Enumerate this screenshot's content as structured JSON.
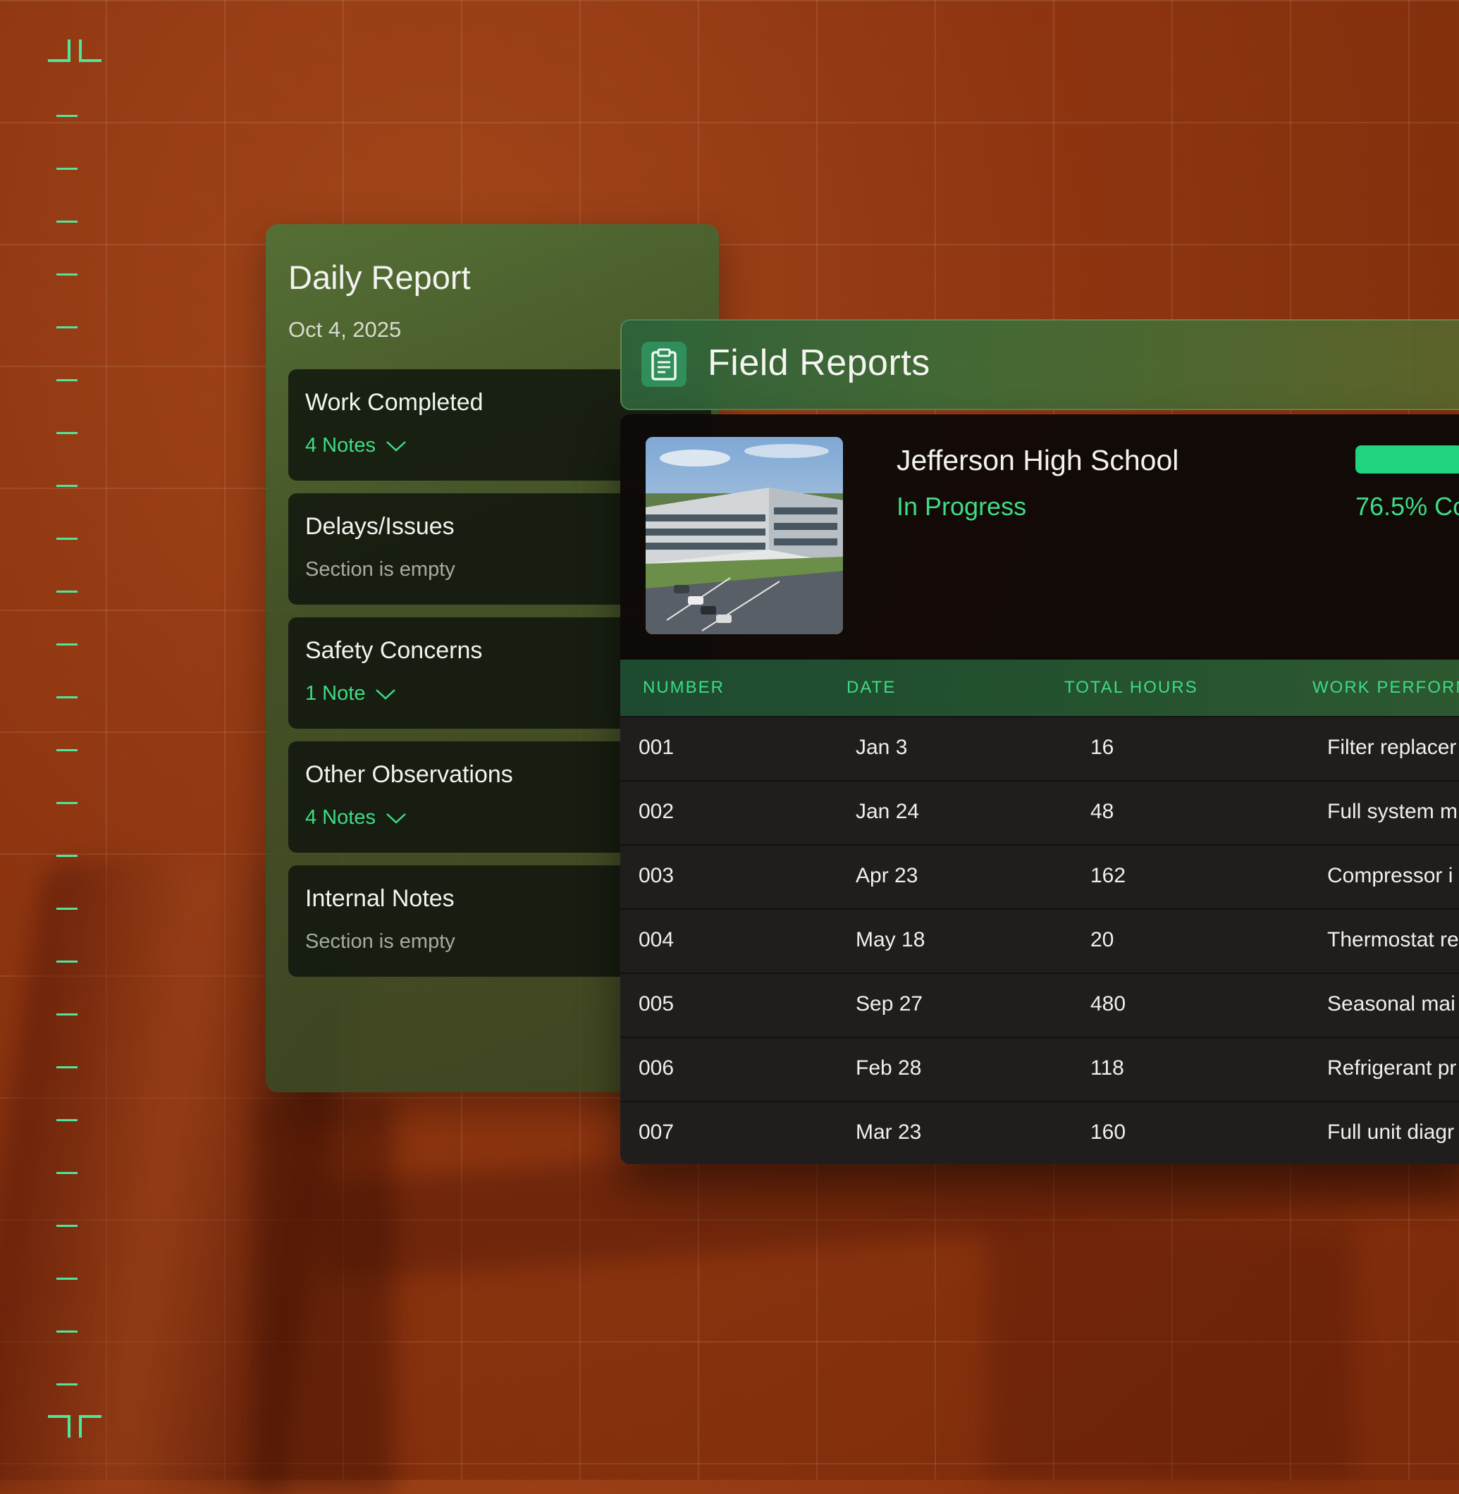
{
  "daily_report": {
    "title": "Daily Report",
    "date": "Oct 4, 2025",
    "sections": [
      {
        "title": "Work Completed",
        "sub": "4 Notes",
        "has_notes": true
      },
      {
        "title": "Delays/Issues",
        "sub": "Section is empty",
        "has_notes": false
      },
      {
        "title": "Safety Concerns",
        "sub": "1 Note",
        "has_notes": true
      },
      {
        "title": "Other Observations",
        "sub": "4 Notes",
        "has_notes": true
      },
      {
        "title": "Internal Notes",
        "sub": "Section is empty",
        "has_notes": false
      }
    ]
  },
  "field_reports": {
    "title": "Field Reports",
    "icon": "clipboard-icon",
    "project": {
      "name": "Jefferson High School",
      "status": "In Progress",
      "progress_percent": 76.5,
      "progress_label": "76.5% Co"
    },
    "table": {
      "headers": [
        "NUMBER",
        "DATE",
        "TOTAL HOURS",
        "WORK PERFORM"
      ],
      "rows": [
        [
          "001",
          "Jan 3",
          "16",
          "Filter replacer"
        ],
        [
          "002",
          "Jan 24",
          "48",
          "Full system m"
        ],
        [
          "003",
          "Apr 23",
          "162",
          "Compressor i"
        ],
        [
          "004",
          "May 18",
          "20",
          "Thermostat re"
        ],
        [
          "005",
          "Sep 27",
          "480",
          "Seasonal mai"
        ],
        [
          "006",
          "Feb 28",
          "118",
          "Refrigerant pr"
        ],
        [
          "007",
          "Mar 23",
          "160",
          "Full unit diagr"
        ]
      ]
    }
  },
  "colors": {
    "accent": "#3ddc85",
    "background": "#8e3510",
    "panel_green": "#3a5228"
  }
}
